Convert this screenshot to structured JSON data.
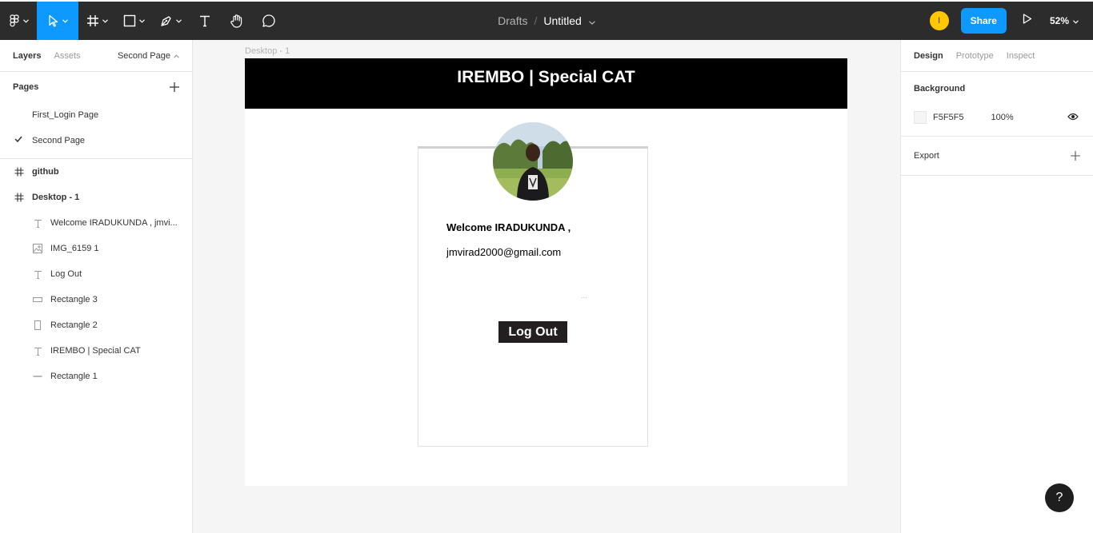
{
  "toolbar": {
    "breadcrumb": "Drafts",
    "separator": "/",
    "file_title": "Untitled",
    "user_initial": "I",
    "share_label": "Share",
    "zoom": "52%"
  },
  "left_panel": {
    "tabs": [
      "Layers",
      "Assets"
    ],
    "current_page": "Second Page",
    "pages_heading": "Pages",
    "pages": [
      {
        "label": "First_Login Page",
        "selected": false
      },
      {
        "label": "Second Page",
        "selected": true
      }
    ],
    "layers": [
      {
        "label": "github",
        "icon": "frame-icon",
        "level": "top"
      },
      {
        "label": "Desktop - 1",
        "icon": "frame-icon",
        "level": "top"
      },
      {
        "label": "Welcome IRADUKUNDA , jmvi...",
        "icon": "text-icon",
        "level": "child"
      },
      {
        "label": "IMG_6159 1",
        "icon": "image-icon",
        "level": "child"
      },
      {
        "label": "Log Out",
        "icon": "text-icon",
        "level": "child"
      },
      {
        "label": "Rectangle 3",
        "icon": "rectangle-icon",
        "level": "child"
      },
      {
        "label": "Rectangle 2",
        "icon": "rectangle-icon",
        "level": "child"
      },
      {
        "label": "IREMBO | Special CAT",
        "icon": "text-icon",
        "level": "child"
      },
      {
        "label": "Rectangle 1",
        "icon": "line-icon",
        "level": "child"
      }
    ]
  },
  "canvas": {
    "frame_label": "Desktop - 1",
    "header_title": "IREMBO | Special CAT",
    "welcome_text": "Welcome IRADUKUNDA ,",
    "email_text": "jmvirad2000@gmail.com",
    "dots": "...",
    "logout_label": "Log Out"
  },
  "right_panel": {
    "tabs": [
      "Design",
      "Prototype",
      "Inspect"
    ],
    "background_heading": "Background",
    "background_hex": "F5F5F5",
    "background_opacity": "100%",
    "export_label": "Export"
  },
  "help": "?",
  "colors": {
    "toolbar_bg": "#2c2c2c",
    "accent": "#0d99ff",
    "user_avatar": "#ffc700",
    "canvas_bg": "#F5F5F5",
    "frame_header": "#000000",
    "logout_button": "#231f20"
  }
}
